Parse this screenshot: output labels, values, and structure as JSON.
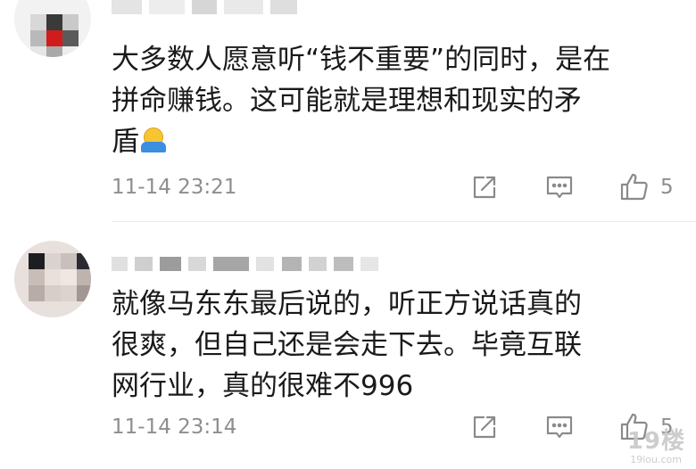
{
  "comments": [
    {
      "text": "大多数人愿意听“钱不重要”的同时，是在\n拼命赚钱。这可能就是理想和现实的矛\n盾",
      "emoji": "shrug-emoji",
      "time": "11-14 23:21",
      "likes": "5"
    },
    {
      "text": "就像马东东最后说的，听正方说话真的\n很爽，但自己还是会走下去。毕竟互联\n网行业，真的很难不996",
      "time": "11-14 23:14",
      "likes": "5"
    }
  ],
  "icons": {
    "share": "share-icon",
    "reply": "comment-icon",
    "like": "thumbs-up-icon"
  },
  "colors": {
    "text": "#1a1a1a",
    "meta": "#8e8e8e",
    "icon": "#8a8a8a"
  },
  "watermark": {
    "main": "19楼",
    "sub": "19lou.com"
  }
}
